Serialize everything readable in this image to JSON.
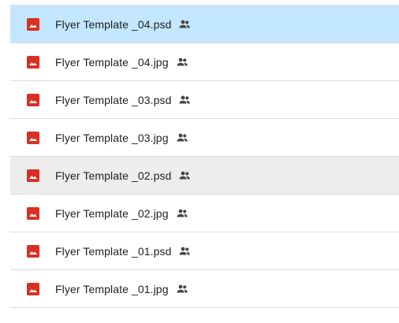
{
  "colors": {
    "image_icon": "#d93025",
    "shared_icon": "#444746",
    "selected_row": "#c2e7ff",
    "hover_row": "#ededed",
    "divider": "#dadce0"
  },
  "files": [
    {
      "name": "Flyer Template _04.psd",
      "icon": "image-icon",
      "shared": true,
      "state": "selected"
    },
    {
      "name": "Flyer Template _04.jpg",
      "icon": "image-icon",
      "shared": true,
      "state": "none"
    },
    {
      "name": "Flyer Template _03.psd",
      "icon": "image-icon",
      "shared": true,
      "state": "none"
    },
    {
      "name": "Flyer Template _03.jpg",
      "icon": "image-icon",
      "shared": true,
      "state": "none"
    },
    {
      "name": "Flyer Template _02.psd",
      "icon": "image-icon",
      "shared": true,
      "state": "hover"
    },
    {
      "name": "Flyer Template _02.jpg",
      "icon": "image-icon",
      "shared": true,
      "state": "none"
    },
    {
      "name": "Flyer Template _01.psd",
      "icon": "image-icon",
      "shared": true,
      "state": "none"
    },
    {
      "name": "Flyer Template _01.jpg",
      "icon": "image-icon",
      "shared": true,
      "state": "none"
    }
  ]
}
